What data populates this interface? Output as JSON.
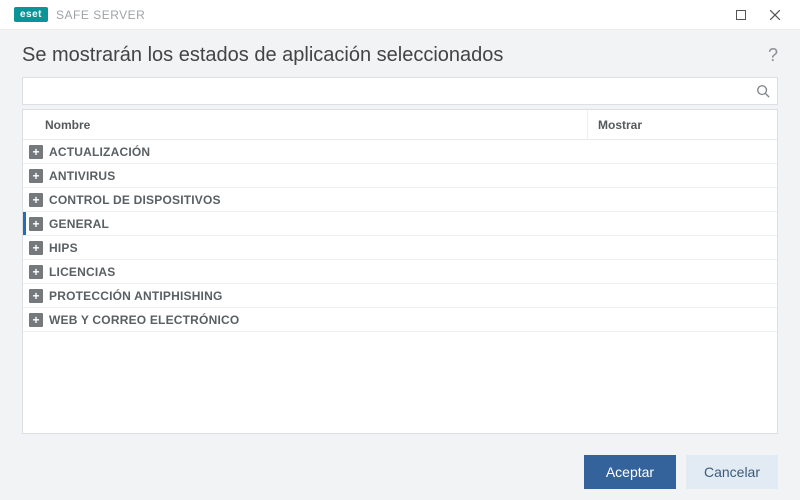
{
  "titlebar": {
    "logo_text": "eset",
    "product_name": "SAFE SERVER"
  },
  "header": {
    "title": "Se mostrarán los estados de aplicación seleccionados",
    "help_symbol": "?"
  },
  "search": {
    "value": "",
    "placeholder": ""
  },
  "table": {
    "columns": {
      "name": "Nombre",
      "mostrar": "Mostrar"
    },
    "rows": [
      {
        "label": "ACTUALIZACIÓN",
        "selected": false
      },
      {
        "label": "ANTIVIRUS",
        "selected": false
      },
      {
        "label": "CONTROL DE DISPOSITIVOS",
        "selected": false
      },
      {
        "label": "GENERAL",
        "selected": true
      },
      {
        "label": "HIPS",
        "selected": false
      },
      {
        "label": "LICENCIAS",
        "selected": false
      },
      {
        "label": "PROTECCIÓN ANTIPHISHING",
        "selected": false
      },
      {
        "label": "WEB Y CORREO ELECTRÓNICO",
        "selected": false
      }
    ]
  },
  "footer": {
    "accept_label": "Aceptar",
    "cancel_label": "Cancelar"
  },
  "icons": {
    "expand_symbol": "+"
  }
}
